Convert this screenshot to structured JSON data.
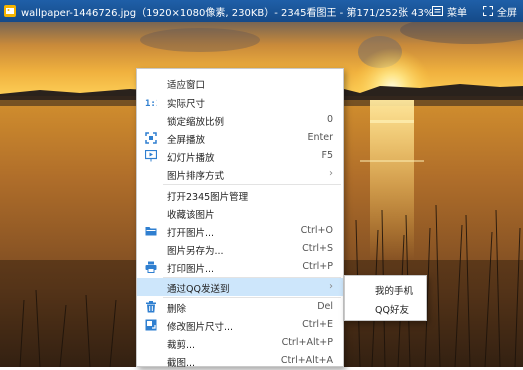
{
  "titlebar": {
    "title": "wallpaper-1446726.jpg（1920×1080像素, 230KB）- 2345看图王 - 第171/252张 43%",
    "menu_label": "菜单",
    "fullscreen_label": "全屏"
  },
  "context_menu": {
    "fit_window": "适应窗口",
    "actual_size": "实际尺寸",
    "lock_zoom": "锁定缩放比例",
    "lock_zoom_shortcut": "0",
    "fullscreen_play": "全屏播放",
    "fullscreen_play_shortcut": "Enter",
    "slideshow": "幻灯片播放",
    "slideshow_shortcut": "F5",
    "sort_order": "图片排序方式",
    "open_manager": "打开2345图片管理",
    "favorite": "收藏该图片",
    "open_image": "打开图片...",
    "open_image_shortcut": "Ctrl+O",
    "save_as": "图片另存为...",
    "save_as_shortcut": "Ctrl+S",
    "print": "打印图片...",
    "print_shortcut": "Ctrl+P",
    "send_qq": "通过QQ发送到",
    "delete": "删除",
    "delete_shortcut": "Del",
    "resize": "修改图片尺寸...",
    "resize_shortcut": "Ctrl+E",
    "crop": "裁剪...",
    "crop_shortcut": "Ctrl+Alt+P",
    "screenshot": "截图...",
    "screenshot_shortcut": "Ctrl+Alt+A"
  },
  "submenu": {
    "my_phone": "我的手机",
    "qq_friend": "QQ好友"
  },
  "colors": {
    "titlebar": "#1a5598",
    "highlight": "#cde6fb",
    "icon_blue": "#2f7fd0"
  }
}
